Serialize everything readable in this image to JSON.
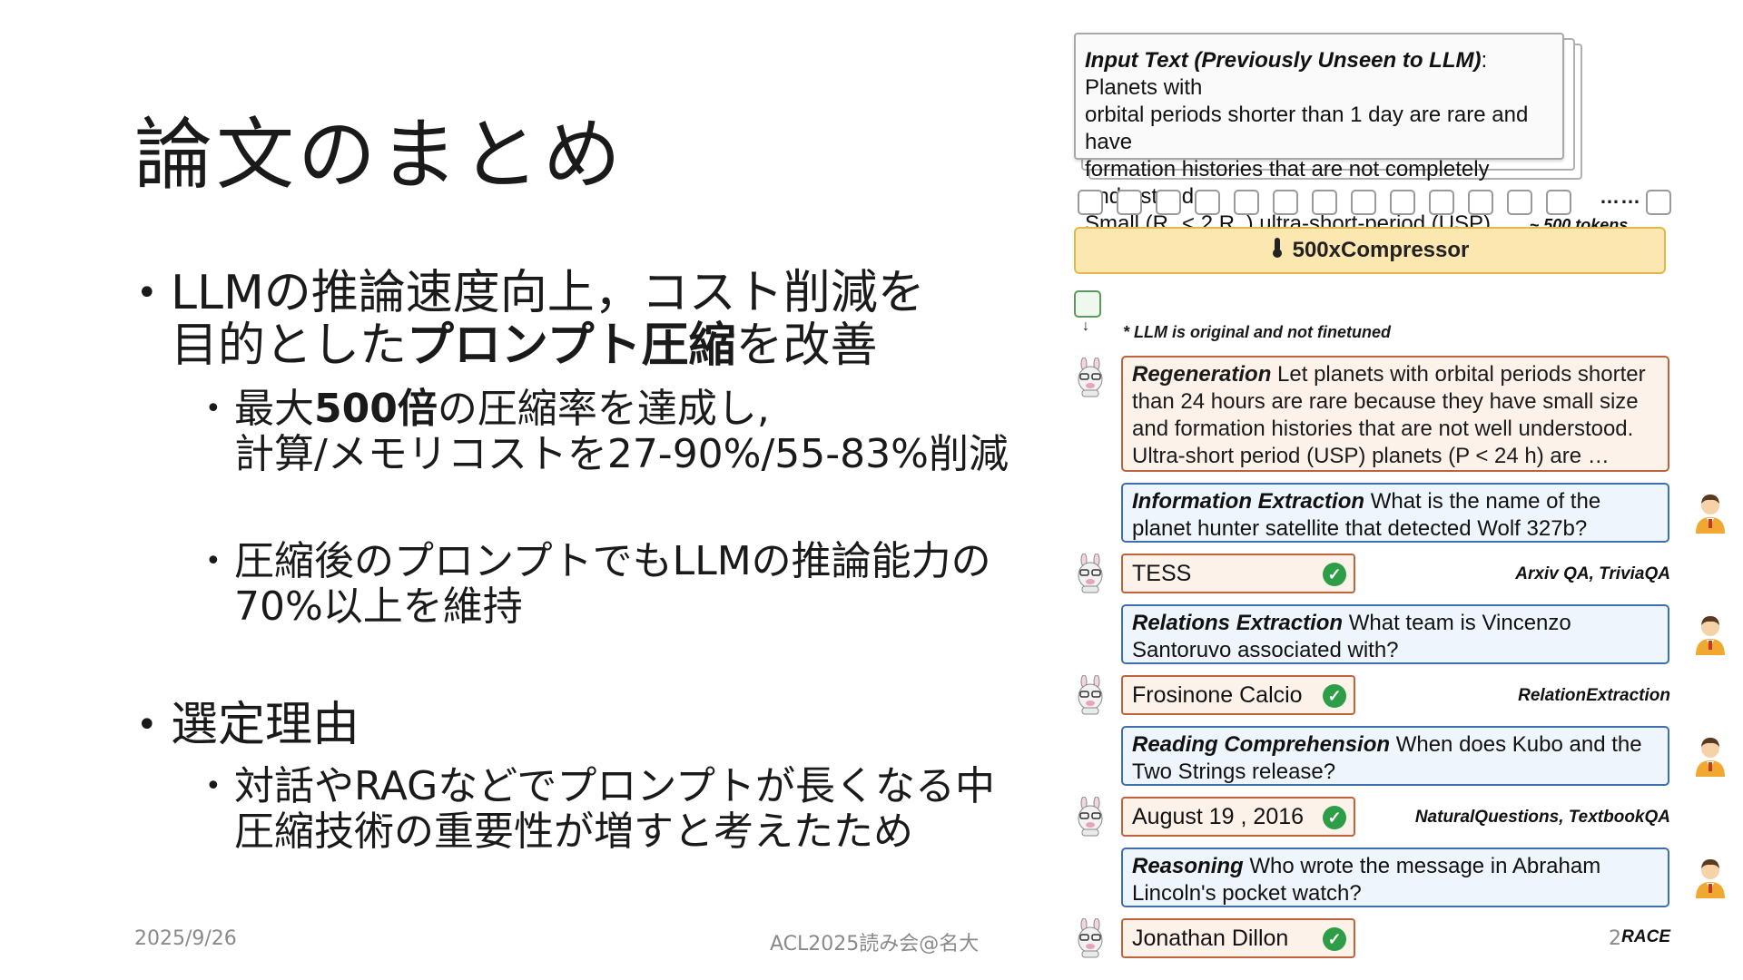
{
  "slide": {
    "title": "論文のまとめ",
    "bullet1": {
      "line1": "LLMの推論速度向上，コスト削減を",
      "line2_pre": "目的とした",
      "line2_bold": "プロンプト圧縮",
      "line2_post": "を改善"
    },
    "sub1": {
      "line1_pre": "最大",
      "line1_bold": "500倍",
      "line1_post": "の圧縮率を達成し,",
      "line2": "計算/メモリコストを27-90%/55-83%削減"
    },
    "sub2": {
      "line1": "圧縮後のプロンプトでもLLMの推論能力の",
      "line2": "70%以上を維持"
    },
    "bullet2": {
      "label": "選定理由"
    },
    "sub3": {
      "line1": "対話やRAGなどでプロンプトが長くなる中",
      "line2": "圧縮技術の重要性が増すと考えたため"
    },
    "footer": {
      "date": "2025/9/26",
      "event": "ACL2025読み会@名大",
      "page": "2"
    }
  },
  "figure": {
    "input": {
      "label": "Input Text (Previously Unseen to LLM)",
      "text1": ": Planets with",
      "text2": "orbital periods shorter than 1 day are rare and have",
      "text3": "formation histories that are not completely understood.",
      "text4_a": "Small (R",
      "text4_p": "p",
      "text4_b": " < 2 R",
      "text4_e": "⊕",
      "text4_c": ") ultra-short-period (USP) …",
      "tokens_note": "~ 500 tokens"
    },
    "dots": "……",
    "compressor": {
      "icon": "thermometer-icon",
      "label": "500xCompressor"
    },
    "note": "* LLM is original and not finetuned",
    "regeneration": {
      "label": "Regeneration",
      "text1": " Let planets with orbital periods shorter",
      "text2": "than 24 hours are rare because they have small size",
      "text3": "and formation histories that are not well understood.",
      "text4": "Ultra-short period (USP) planets (P < 24 h) are …"
    },
    "qa": [
      {
        "label": "Information Extraction",
        "q1": " What is the name of the",
        "q2": "planet hunter satellite that detected Wolf 327b?",
        "answer": "TESS",
        "dataset": "Arxiv QA, TriviaQA"
      },
      {
        "label": "Relations Extraction",
        "q1": " What team is Vincenzo",
        "q2": "Santoruvo associated with?",
        "answer": "Frosinone Calcio",
        "dataset": "RelationExtraction"
      },
      {
        "label": "Reading Comprehension",
        "q1": " When does Kubo and the",
        "q2": "Two Strings release?",
        "answer": "August 19 , 2016",
        "dataset": "NaturalQuestions, TextbookQA"
      },
      {
        "label": "Reasoning",
        "q1": " Who wrote the message in Abraham",
        "q2": "Lincoln's pocket watch?",
        "answer": "Jonathan Dillon",
        "dataset": "RACE"
      }
    ],
    "check_glyph": "✓"
  }
}
